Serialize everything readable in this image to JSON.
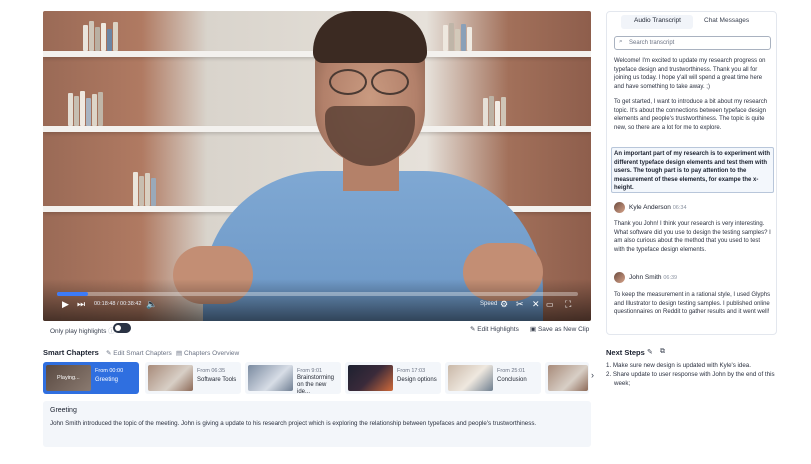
{
  "video": {
    "time_current": "00:18:48",
    "time_total": "00:38:42",
    "progress": 0.06,
    "speed_label": "Speed"
  },
  "below_video": {
    "highlights_label": "Only play highlights",
    "edit_highlights": "Edit Highlights",
    "save_clip": "Save as New Clip"
  },
  "chapters": {
    "heading": "Smart Chapters",
    "edit_label": "Edit Smart Chapters",
    "overview_label": "Chapters Overview",
    "items": [
      {
        "thumb_label": "Playing...",
        "from": "From 00:00",
        "title": "Greeting"
      },
      {
        "from": "From 06:35",
        "title": "Software Tools"
      },
      {
        "from": "From 9:01",
        "title": "Brainstorming on the new ide..."
      },
      {
        "from": "From 17:03",
        "title": "Design options"
      },
      {
        "from": "From 25:01",
        "title": "Conclusion"
      }
    ],
    "next_arrow": "›"
  },
  "summary": {
    "title": "Greeting",
    "text": "John Smith introduced the topic of the meeting. John is giving a  update to his research project which is exploring the relationship between typefaces and people's trustworthiness."
  },
  "panel": {
    "tabs": [
      "Audio Transcript",
      "Chat Messages"
    ],
    "search_placeholder": "Search transcript",
    "paragraphs": [
      "Welcome! I'm excited to update my research progress on typeface design and trustworthiness. Thank you all for joining us today. I hope y'all will spend a great time here and have something to take away. ;)",
      "To get started, I want to introduce a bit about my research topic. It's about the connections between typeface design elements and people's trustworthiness. The topic is quite new, so there are a lot for me to explore.",
      "An important part of my research is to experiment with different typeface design elements and test them with users. The tough part is to pay attention to the measurement of these elements, for exampe the x-height."
    ],
    "speakers": [
      {
        "name": "Kyle Anderson",
        "time": "06:34",
        "text": "Thank you John! I think your research is very interesting. What software did you use to design the testing samples? I am also curious about the method that you used to test with the typeface design elements."
      },
      {
        "name": "John Smith",
        "time": "06:39",
        "text": "To keep the measurement in a rational style, I used Glyphs and Illustrator to design testing samples. I published online questionnaires on Reddit to gather results and it went well!"
      }
    ]
  },
  "next_steps": {
    "heading": "Next Steps",
    "items": [
      "1. Make sure new design is updated with Kyle's idea.",
      "2. Share update to user response with John by the end of this week;"
    ]
  }
}
